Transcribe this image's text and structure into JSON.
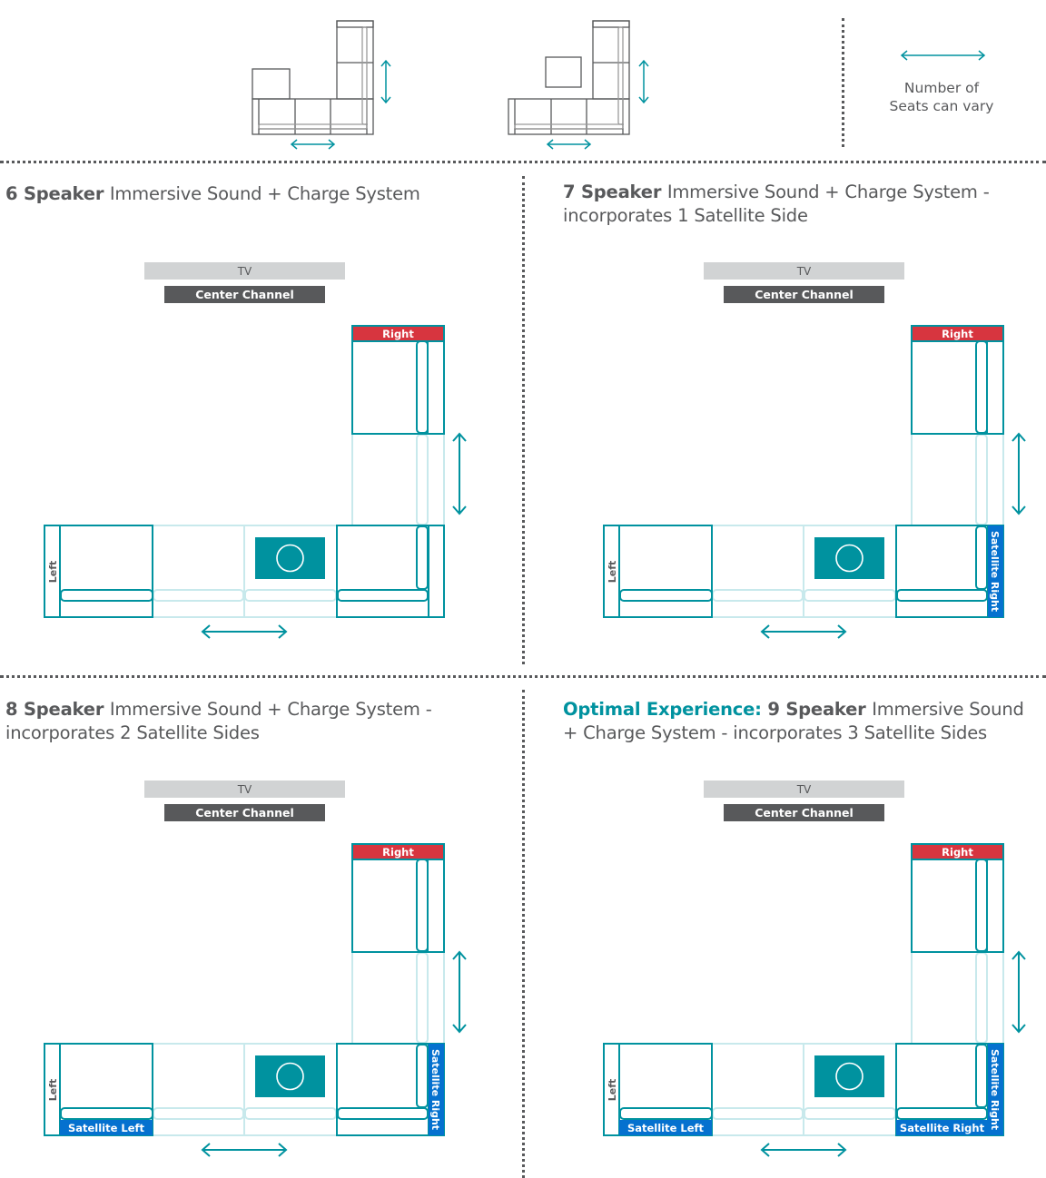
{
  "colors": {
    "teal": "#00929f",
    "teal_light": "#c8e9ec",
    "gray_dark": "#58595b",
    "gray_light": "#d1d3d4",
    "red": "#d7353f",
    "blue": "#0571cf"
  },
  "legend": {
    "seats_vary_line1": "Number of",
    "seats_vary_line2": "Seats can vary",
    "icon": "double-arrow-horizontal-icon"
  },
  "panels": [
    {
      "title_bold": "6 Speaker ",
      "title_rest": "Immersive Sound + Charge System",
      "title_line2": "",
      "tv_label": "TV",
      "center_label": "Center Channel",
      "right_label": "Right",
      "left_label": "Left",
      "satellite_left": "",
      "satellite_right_side": "",
      "satellite_right_bottom": ""
    },
    {
      "title_bold": "7 Speaker ",
      "title_rest": "Immersive Sound + Charge System -",
      "title_line2": "incorporates 1 Satellite Side",
      "tv_label": "TV",
      "center_label": "Center Channel",
      "right_label": "Right",
      "left_label": "Left",
      "satellite_left": "",
      "satellite_right_side": "Satellite Right",
      "satellite_right_bottom": ""
    },
    {
      "title_bold": "8 Speaker ",
      "title_rest": "Immersive Sound + Charge System -",
      "title_line2": "incorporates 2 Satellite Sides",
      "tv_label": "TV",
      "center_label": "Center Channel",
      "right_label": "Right",
      "left_label": "Left",
      "satellite_left": "Satellite Left",
      "satellite_right_side": "Satellite Right",
      "satellite_right_bottom": ""
    },
    {
      "title_accent": "Optimal Experience: ",
      "title_bold": "9 Speaker ",
      "title_rest": "Immersive Sound",
      "title_line2": "+ Charge System - incorporates 3 Satellite Sides",
      "tv_label": "TV",
      "center_label": "Center Channel",
      "right_label": "Right",
      "left_label": "Left",
      "satellite_left": "Satellite Left",
      "satellite_right_side": "Satellite Right",
      "satellite_right_bottom": "Satellite Right"
    }
  ]
}
